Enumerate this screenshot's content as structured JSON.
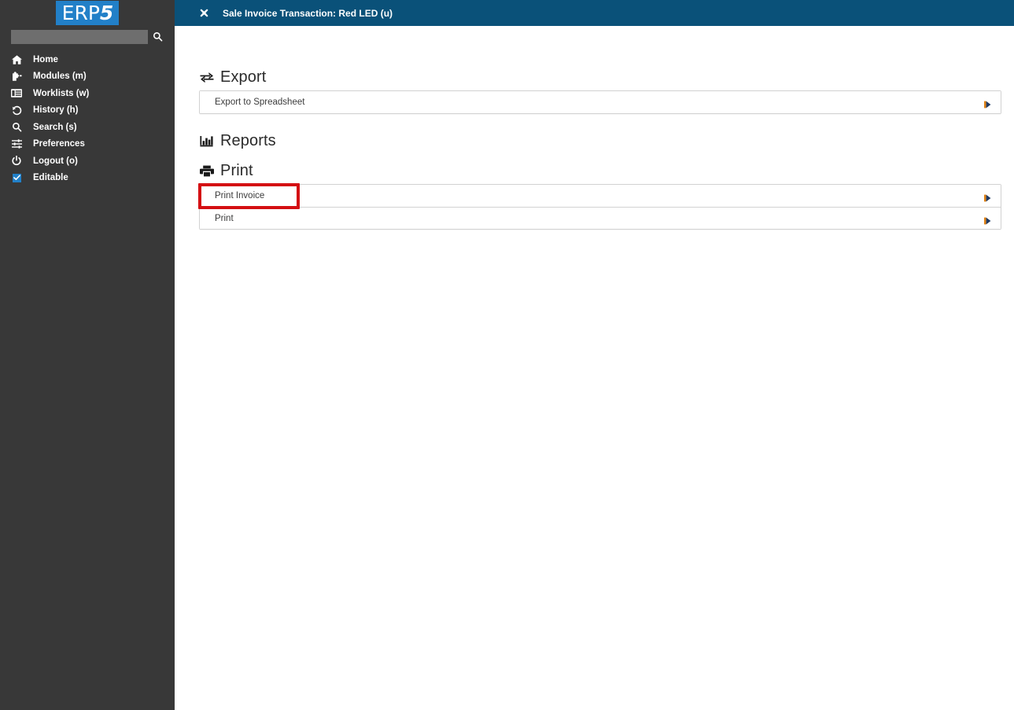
{
  "sidebar": {
    "logo": {
      "prefix": "ERP",
      "suffix": "5"
    },
    "search": {
      "value": "",
      "placeholder": "",
      "icon": "search-icon"
    },
    "items": [
      {
        "label": "Home",
        "icon": "home-icon"
      },
      {
        "label": "Modules (m)",
        "icon": "puzzle-piece-icon"
      },
      {
        "label": "Worklists (w)",
        "icon": "worklist-icon"
      },
      {
        "label": "History (h)",
        "icon": "history-icon"
      },
      {
        "label": "Search (s)",
        "icon": "search-icon"
      },
      {
        "label": "Preferences",
        "icon": "sliders-icon"
      },
      {
        "label": "Logout (o)",
        "icon": "power-icon"
      },
      {
        "label": "Editable",
        "icon": "checkbox-checked-icon",
        "checked": true
      }
    ]
  },
  "header": {
    "close_icon": "close-icon",
    "title": "Sale Invoice Transaction: Red LED (u)"
  },
  "main": {
    "sections": [
      {
        "title": "Export",
        "icon": "exchange-arrows-icon",
        "rows": [
          {
            "label": "Export to Spreadsheet",
            "arrow": "play-right-icon"
          }
        ]
      },
      {
        "title": "Reports",
        "icon": "bar-chart-icon",
        "rows": []
      },
      {
        "title": "Print",
        "icon": "printer-icon",
        "rows": [
          {
            "label": "Print Invoice",
            "arrow": "play-right-icon",
            "highlighted": true
          },
          {
            "label": "Print",
            "arrow": "play-right-icon"
          }
        ]
      }
    ]
  },
  "colors": {
    "sidebar_bg": "#383838",
    "header_bg": "#0a5179",
    "logo_bg": "#2280c8",
    "accent_blue": "#2280c8",
    "highlight_red": "#d40f13",
    "border_grey": "#d2d2d2",
    "text_dark": "#3b3b3b"
  }
}
